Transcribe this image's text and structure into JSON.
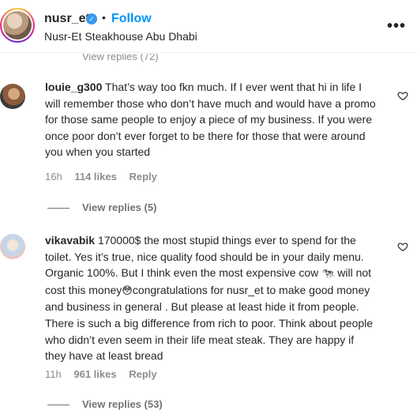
{
  "header": {
    "username": "nusr_et",
    "separator": "•",
    "follow_label": "Follow",
    "location": "Nusr-Et Steakhouse Abu Dhabi",
    "more_label": "•••"
  },
  "partial_replies": {
    "label": "View replies (72)"
  },
  "comments": [
    {
      "username": "louie_g300",
      "text": "That’s way too fkn much. If I ever went that hi in life I will remember those who don’t have much and would have a promo for those same people to enjoy a piece of my business. If you were once poor don’t ever forget to be there for those that were around you when you started",
      "time": "16h",
      "likes": "114 likes",
      "reply_label": "Reply",
      "view_replies": "View replies (5)"
    },
    {
      "username": "vikavabik",
      "text_part1": "170000$ the most stupid things ever to spend for the toilet. Yes it’s true, nice quality food should be in your daily menu. Organic 100%. But I think even the most expensive cow ",
      "emoji_cow": "🐄",
      "text_part2": " will not cost this money",
      "emoji_face": "😳",
      "text_part3": "congratulations for nusr_et to make good money and business in general . But please at least hide it from people. There is such a big difference from rich to poor. Think about people who didn’t even seem in their life meat steak. They are happy if they have at least bread",
      "time": "11h",
      "likes": "961 likes",
      "reply_label": "Reply",
      "view_replies": "View replies (53)"
    }
  ],
  "colors": {
    "link_blue": "#0095f6",
    "muted_gray": "#8e8e8e",
    "text": "#262626"
  }
}
